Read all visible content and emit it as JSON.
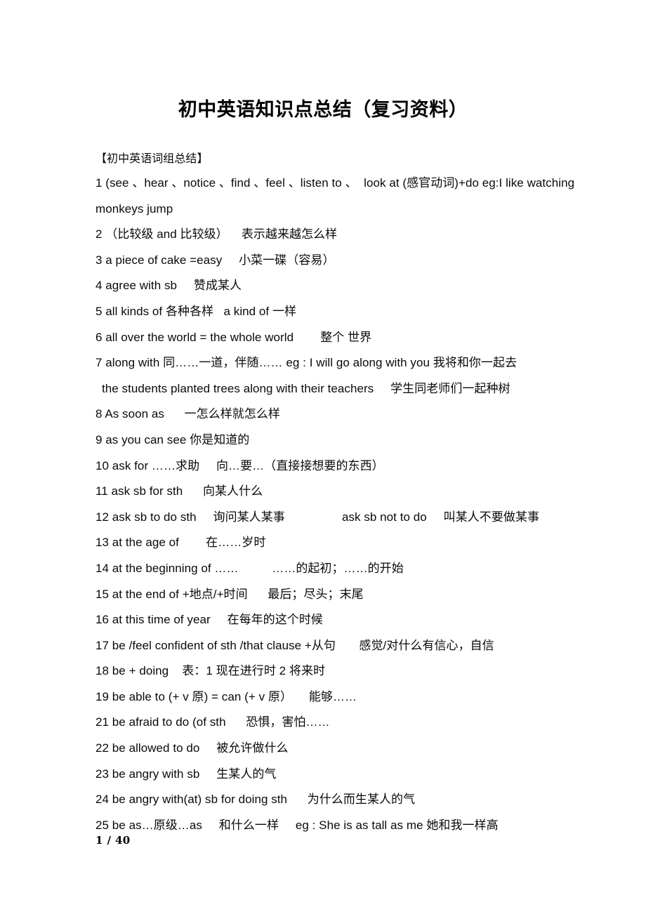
{
  "document": {
    "title": "初中英语知识点总结（复习资料）",
    "section_heading": "【初中英语词组总结】",
    "footer": {
      "page_label": "1 / 40",
      "current_page": 1,
      "total_pages": 40
    }
  },
  "entries": [
    {
      "number": "1",
      "text": "1 (see 、hear 、notice 、find 、feel 、listen to 、  look at (感官动词)+do eg:I like watching",
      "indent": false
    },
    {
      "number": "1b",
      "text": "monkeys jump",
      "indent": false
    },
    {
      "number": "2",
      "text": "2 （比较级 and 比较级）    表示越来越怎么样",
      "indent": false
    },
    {
      "number": "3",
      "text": "3 a piece of cake =easy     小菜一碟（容易）",
      "indent": false
    },
    {
      "number": "4",
      "text": "4 agree with sb     赞成某人",
      "indent": false
    },
    {
      "number": "5",
      "text": "5 all kinds of 各种各样   a kind of 一样",
      "indent": false
    },
    {
      "number": "6",
      "text": "6 all over the world = the whole world        整个 世界",
      "indent": false
    },
    {
      "number": "7",
      "text": "7 along with 同……一道，伴随…… eg : I will go along with you 我将和你一起去",
      "indent": false
    },
    {
      "number": "7b",
      "text": "the students planted trees along with their teachers     学生同老师们一起种树",
      "indent": true
    },
    {
      "number": "8",
      "text": "8 As soon as      一怎么样就怎么样",
      "indent": false
    },
    {
      "number": "9",
      "text": "9 as you can see 你是知道的",
      "indent": false
    },
    {
      "number": "10",
      "text": "10 ask for ……求助     向…要…（直接接想要的东西）",
      "indent": false
    },
    {
      "number": "11",
      "text": "11 ask sb for sth      向某人什么",
      "indent": false
    },
    {
      "number": "12",
      "text": "12 ask sb to do sth     询问某人某事                 ask sb not to do     叫某人不要做某事",
      "indent": false
    },
    {
      "number": "13",
      "text": "13 at the age of        在……岁时",
      "indent": false
    },
    {
      "number": "14",
      "text": "14 at the beginning of ……          ……的起初；……的开始",
      "indent": false
    },
    {
      "number": "15",
      "text": "15 at the end of +地点/+时间      最后；尽头；末尾",
      "indent": false
    },
    {
      "number": "16",
      "text": "16 at this time of year     在每年的这个时候",
      "indent": false
    },
    {
      "number": "17",
      "text": "17 be /feel confident of sth /that clause +从句       感觉/对什么有信心，自信",
      "indent": false
    },
    {
      "number": "18",
      "text": "18 be + doing    表：1 现在进行时 2 将来时",
      "indent": false
    },
    {
      "number": "19",
      "text": "19 be able to (+ v 原) = can (+ v 原）     能够……",
      "indent": false
    },
    {
      "number": "21",
      "text": "21 be afraid to do (of sth      恐惧，害怕……",
      "indent": false
    },
    {
      "number": "22",
      "text": "22 be allowed to do     被允许做什么",
      "indent": false
    },
    {
      "number": "23",
      "text": "23 be angry with sb     生某人的气",
      "indent": false
    },
    {
      "number": "24",
      "text": "24 be angry with(at) sb for doing sth      为什么而生某人的气",
      "indent": false
    },
    {
      "number": "25",
      "text": "25 be as…原级…as     和什么一样     eg : She is as tall as me 她和我一样高",
      "indent": false
    }
  ]
}
